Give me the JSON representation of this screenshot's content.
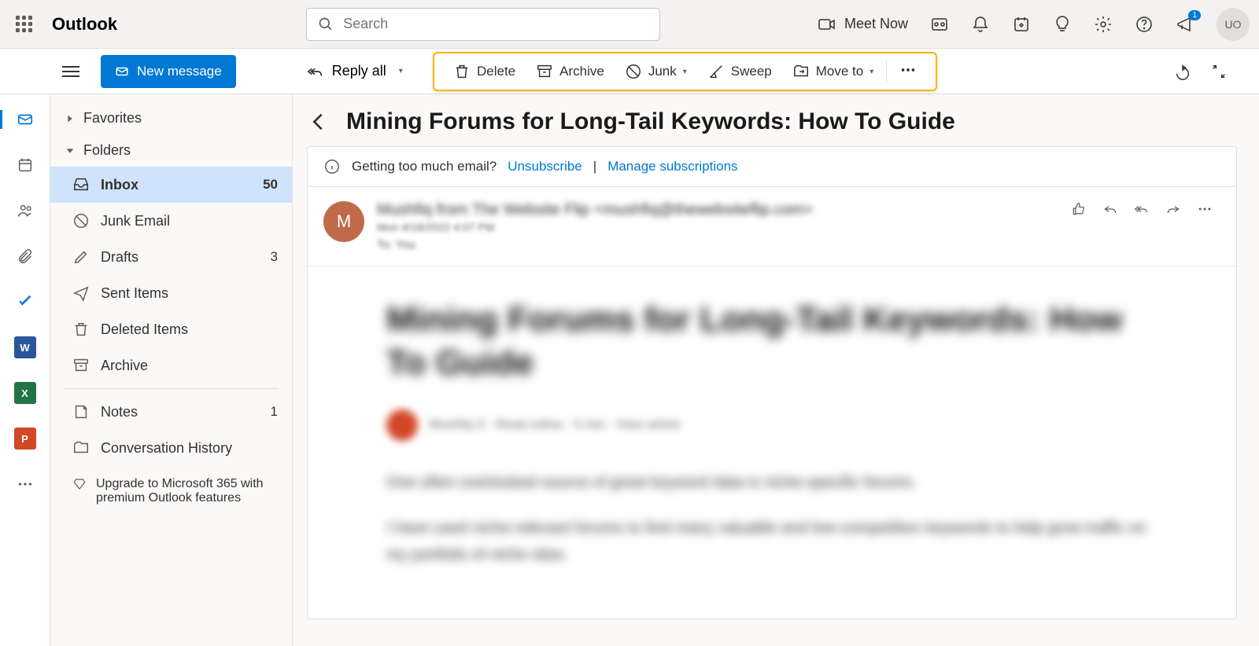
{
  "brand": "Outlook",
  "search": {
    "placeholder": "Search"
  },
  "header": {
    "meet_now": "Meet Now",
    "notif_badge": "1",
    "avatar_initials": "UO"
  },
  "toolbar": {
    "new_message": "New message",
    "reply_all": "Reply all",
    "delete": "Delete",
    "archive": "Archive",
    "junk": "Junk",
    "sweep": "Sweep",
    "move_to": "Move to"
  },
  "sidebar": {
    "favorites": "Favorites",
    "folders": "Folders",
    "items": [
      {
        "name": "Inbox",
        "count": "50",
        "icon": "inbox"
      },
      {
        "name": "Junk Email",
        "count": "",
        "icon": "junk"
      },
      {
        "name": "Drafts",
        "count": "3",
        "icon": "drafts"
      },
      {
        "name": "Sent Items",
        "count": "",
        "icon": "sent"
      },
      {
        "name": "Deleted Items",
        "count": "",
        "icon": "trash"
      },
      {
        "name": "Archive",
        "count": "",
        "icon": "archive"
      },
      {
        "name": "Notes",
        "count": "1",
        "icon": "notes"
      },
      {
        "name": "Conversation History",
        "count": "",
        "icon": "folder"
      }
    ],
    "upgrade": "Upgrade to Microsoft 365 with premium Outlook features"
  },
  "reading": {
    "subject": "Mining Forums for Long-Tail Keywords: How To Guide",
    "info_text": "Getting too much email?",
    "unsubscribe": "Unsubscribe",
    "manage": "Manage subscriptions",
    "sep": " | ",
    "sender_avatar": "M",
    "sender_name": "Mushfiq from The Website Flip <mushfiq@thewebsiteflip.com>",
    "sender_date": "Mon 4/18/2022 4:07 PM",
    "sender_to": "To: You",
    "body_title": "Mining Forums for Long-Tail Keywords: How To Guide",
    "byline": "Mushfiq S · Read online · 5 min · View article",
    "para1": "One often overlooked source of great keyword data is niche-specific forums.",
    "para2": "I have used niche-relevant forums to find many valuable and low-competition keywords to help grow traffic on my portfolio of niche sites."
  }
}
